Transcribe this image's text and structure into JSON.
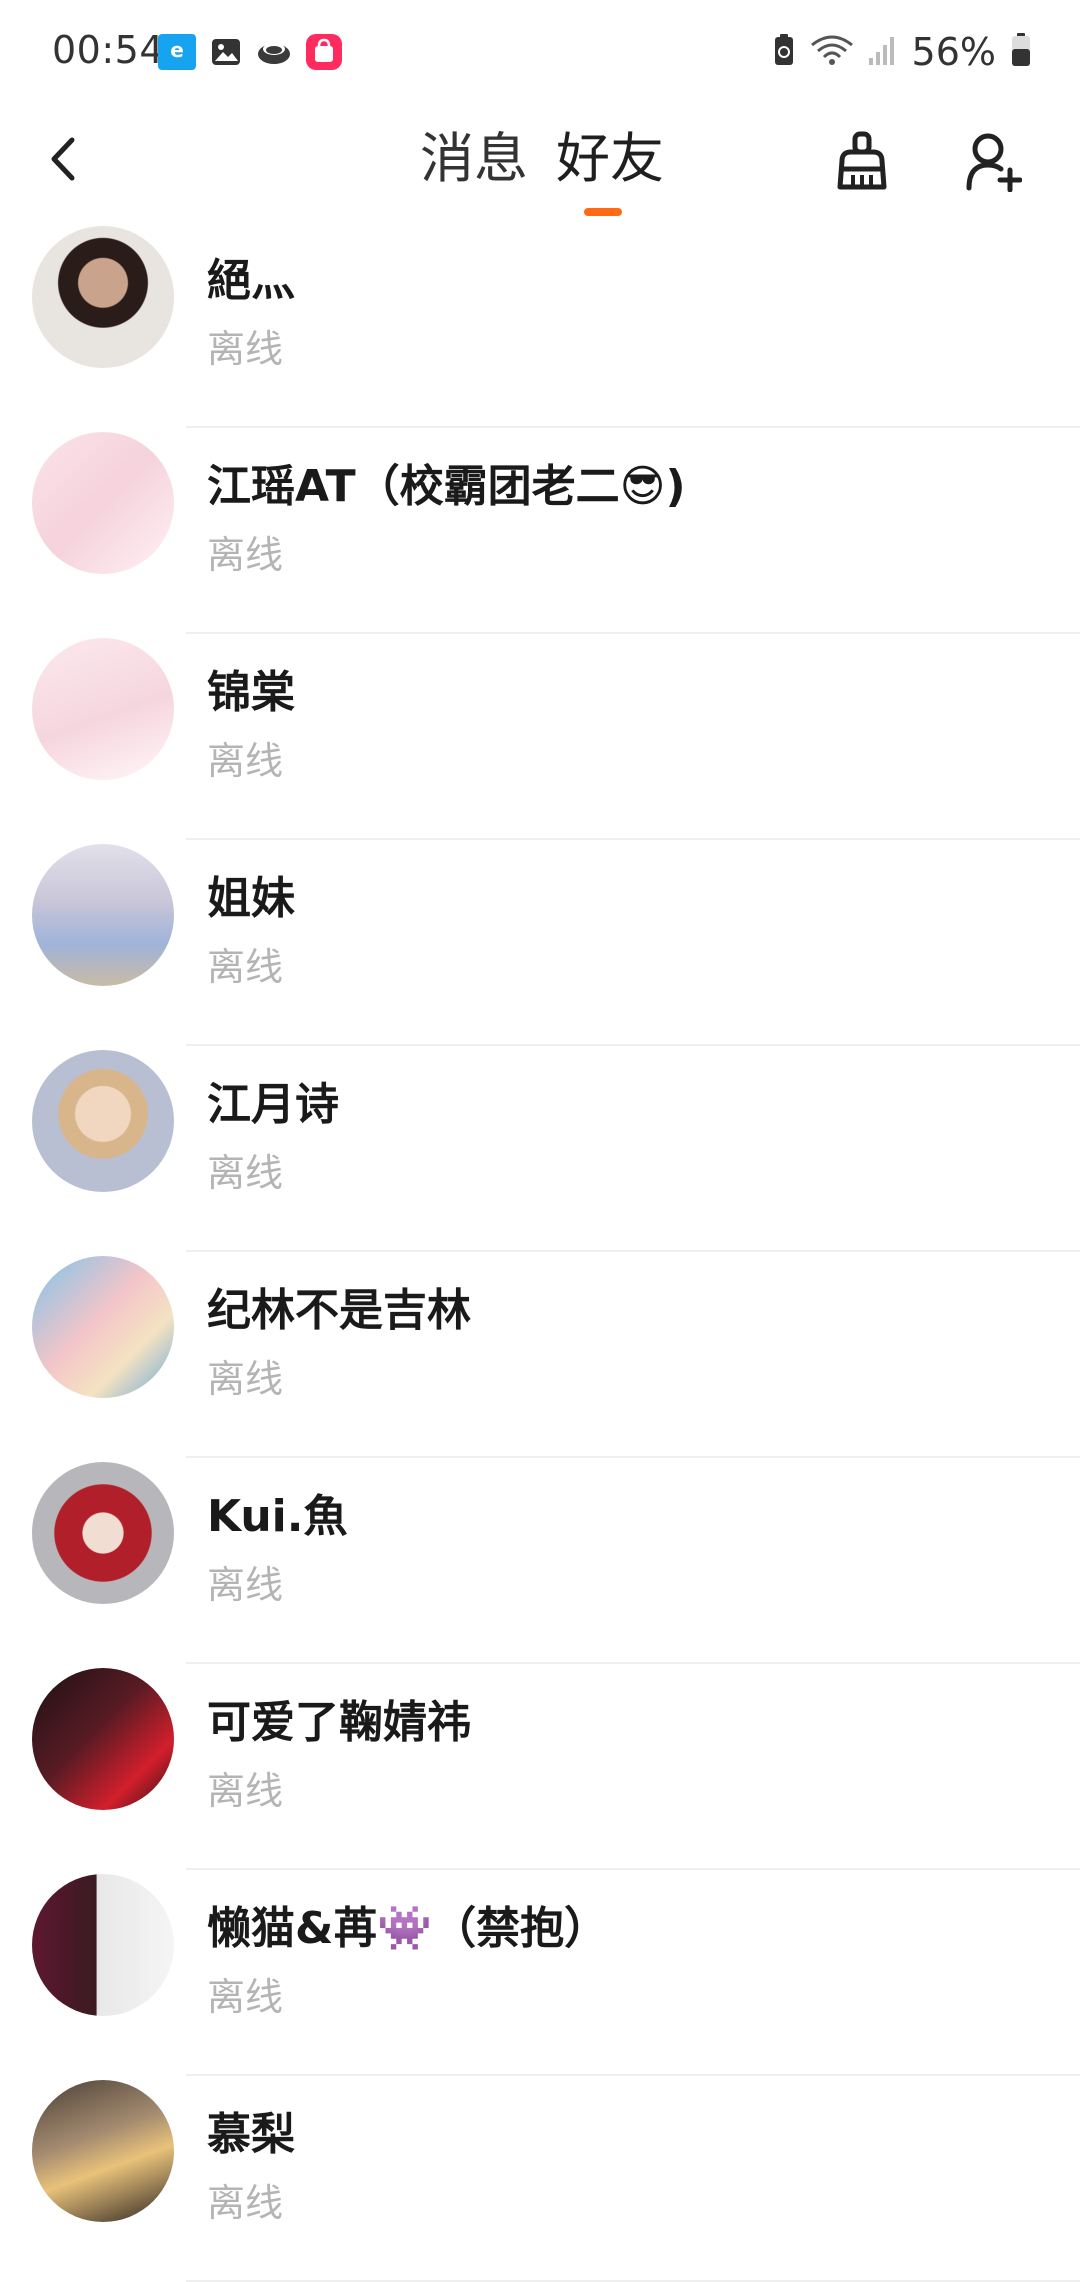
{
  "status_bar": {
    "time": "00:54",
    "battery_percent": "56%",
    "left_icons": [
      "eleme-app-icon",
      "gallery-icon",
      "sprout-icon",
      "shopping-bag-icon"
    ],
    "right_icons": [
      "battery-saver-icon",
      "wifi-icon",
      "signal-icon",
      "battery-icon"
    ]
  },
  "header": {
    "back_icon": "chevron-left-icon",
    "tabs": [
      {
        "label": "消息",
        "active": false
      },
      {
        "label": "好友",
        "active": true
      }
    ],
    "actions": [
      {
        "name": "clean-icon"
      },
      {
        "name": "add-user-icon"
      }
    ],
    "accent_color": "#ff6a13"
  },
  "friends": [
    {
      "name": "絕灬",
      "status": "离线"
    },
    {
      "name": "江瑶AT（校霸团老二😎)",
      "status": "离线"
    },
    {
      "name": "锦棠",
      "status": "离线"
    },
    {
      "name": "姐妹",
      "status": "离线"
    },
    {
      "name": "江月诗",
      "status": "离线"
    },
    {
      "name": "纪林不是吉林",
      "status": "离线"
    },
    {
      "name": "Kui.魚",
      "status": "离线"
    },
    {
      "name": "可爱了鞠婧祎",
      "status": "离线"
    },
    {
      "name": "懒猫&苒👾（禁抱）",
      "status": "离线"
    },
    {
      "name": "慕梨",
      "status": "离线"
    }
  ]
}
